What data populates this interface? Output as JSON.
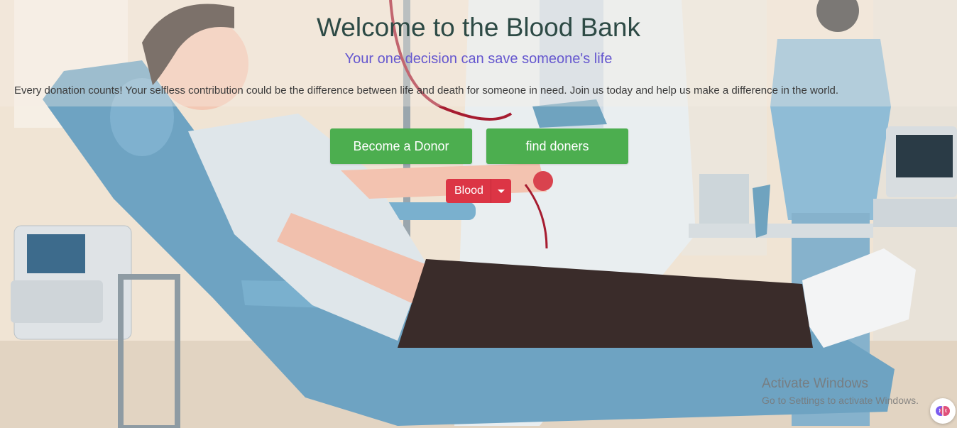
{
  "hero": {
    "title": "Welcome to the Blood Bank",
    "subtitle": "Your one decision can save someone's life",
    "description": "Every donation counts! Your selfless contribution could be the difference between life and death for someone in need. Join us today and help us make a difference in the world."
  },
  "actions": {
    "become_donor_label": "Become a Donor",
    "find_donors_label": "find doners"
  },
  "dropdown": {
    "selected": "Blood"
  },
  "watermark": {
    "title": "Activate Windows",
    "subtitle": "Go to Settings to activate Windows."
  },
  "colors": {
    "title": "#2d4a45",
    "subtitle": "#6658cf",
    "button_green": "#4cae4f",
    "dropdown_red": "#dc3545"
  },
  "icons": {
    "dropdown": "caret-down-icon",
    "extension": "brain-extension-icon"
  }
}
